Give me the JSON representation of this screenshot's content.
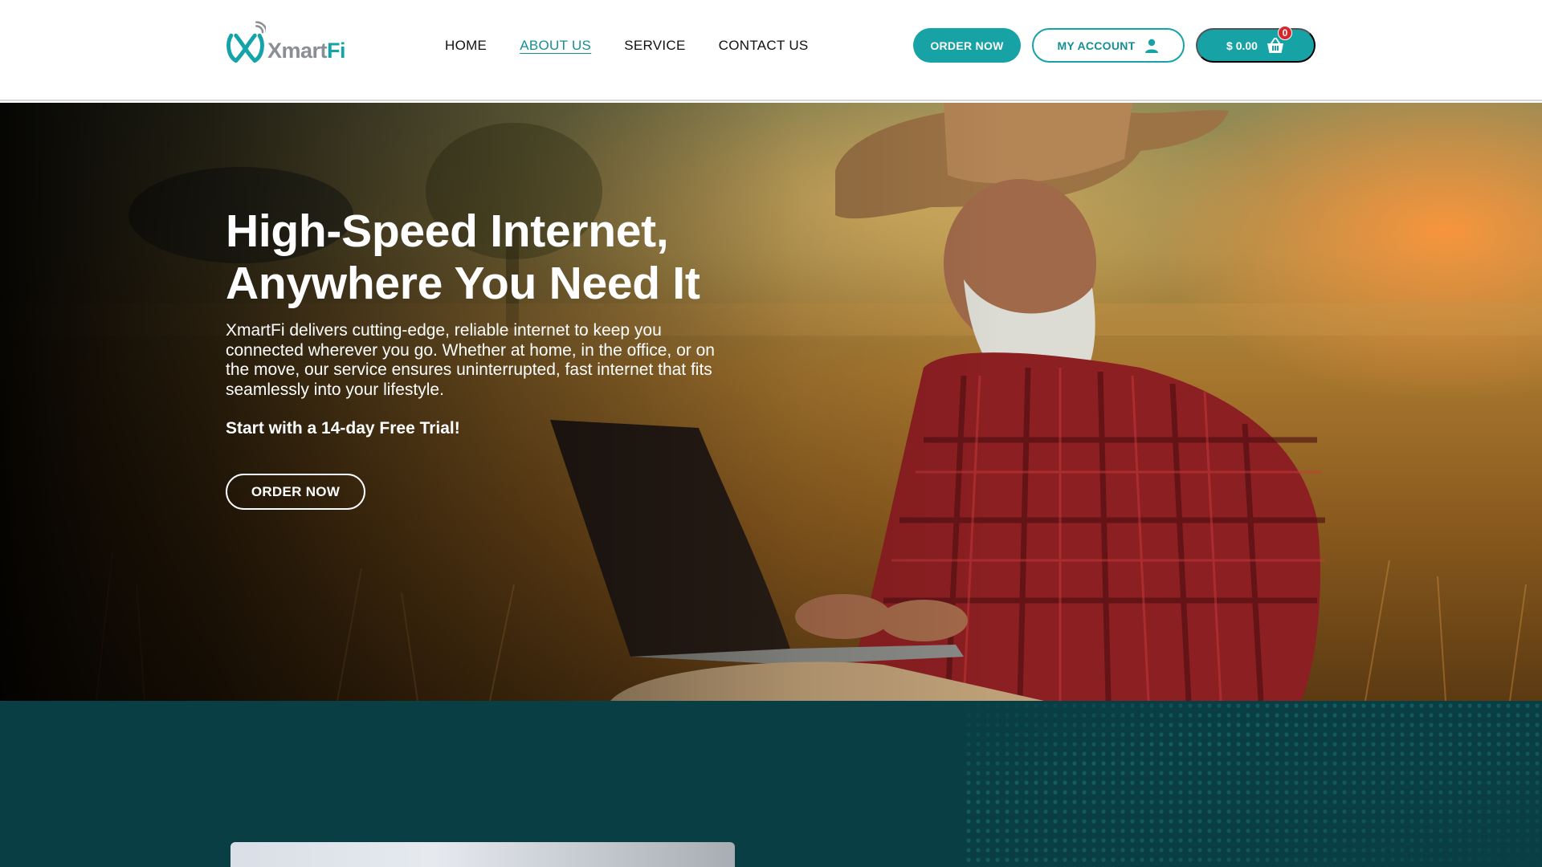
{
  "header": {
    "logo": {
      "brand_prefix": "Xmart",
      "brand_suffix": "Fi",
      "icon": "xmartfi-logo-icon"
    },
    "nav": [
      {
        "label": "HOME",
        "active": false
      },
      {
        "label": "ABOUT US",
        "active": true
      },
      {
        "label": "SERVICE",
        "active": false
      },
      {
        "label": "CONTACT US",
        "active": false
      }
    ],
    "order_button": "ORDER NOW",
    "account_button": {
      "label": "MY ACCOUNT",
      "icon": "user-icon"
    },
    "cart": {
      "amount": "$ 0.00",
      "count": "0",
      "icon": "shopping-basket-icon"
    }
  },
  "hero": {
    "title_line1": "High-Speed Internet,",
    "title_line2": "Anywhere You Need It",
    "description": "XmartFi delivers cutting-edge, reliable internet to keep you connected wherever you go. Whether at home, in the office, or on the move, our service ensures uninterrupted, fast internet that fits seamlessly into your lifestyle.",
    "trial": "Start with a 14-day Free Trial!",
    "cta": "ORDER NOW"
  },
  "colors": {
    "primary": "#17a2a5",
    "dark_teal": "#093f44",
    "badge": "#d9262a"
  }
}
